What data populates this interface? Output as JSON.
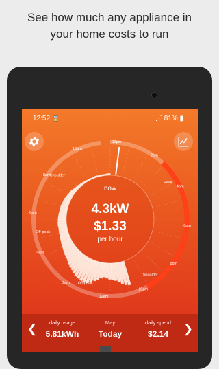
{
  "headline": [
    "See how much any appliance in",
    "your home costs to run"
  ],
  "status_bar": {
    "time": "12:52",
    "battery": "81%"
  },
  "dial": {
    "hour_labels": [
      "10am",
      "12pm",
      "2pm",
      "4pm",
      "6pm",
      "8pm",
      "10pm",
      "12am",
      "2am",
      "4am",
      "6am",
      "8am"
    ],
    "period_labels": [
      "Peak",
      "Shoulder",
      "Off-peak",
      "Off-peak",
      "Shoulder"
    ],
    "usage_profile": [
      0.08,
      0.07,
      0.06,
      0.06,
      0.07,
      0.06,
      0.07,
      0.06,
      0.05,
      0.06,
      0.06,
      0.07,
      0.08,
      0.09,
      0.1,
      0.12,
      0.13,
      0.15,
      0.17,
      0.19,
      0.2,
      0.22,
      0.24,
      0.26,
      0.27,
      0.28,
      0.3,
      0.3,
      0.31,
      0.32,
      0.33,
      0.34,
      0.35,
      0.36,
      0.36,
      0.35,
      0.36,
      0.37,
      0.38,
      0.4,
      0.42,
      0.44,
      0.47,
      0.5,
      0.53,
      0.56,
      0.6,
      0.64,
      0.7,
      0.75,
      0.8,
      0.86,
      0.92,
      0.95,
      0.98,
      1.0,
      0.97,
      0.9,
      0.8,
      0.72,
      0.64,
      0.58,
      0.62,
      0.66,
      0.68,
      0.72,
      0.8,
      0.88,
      0.96,
      1.0
    ],
    "current_position": 0.02
  },
  "center": {
    "now_label": "now",
    "power": "4.3kW",
    "cost": "$1.33",
    "cost_unit": "per hour"
  },
  "footer": {
    "usage_label": "daily usage",
    "usage_value": "5.81kWh",
    "month_label": "May",
    "month_value": "Today",
    "spend_label": "daily spend",
    "spend_value": "$2.14"
  },
  "icons": {
    "settings": "gear-icon",
    "trend": "line-chart-icon",
    "prev": "chevron-left-icon",
    "next": "chevron-right-icon"
  }
}
